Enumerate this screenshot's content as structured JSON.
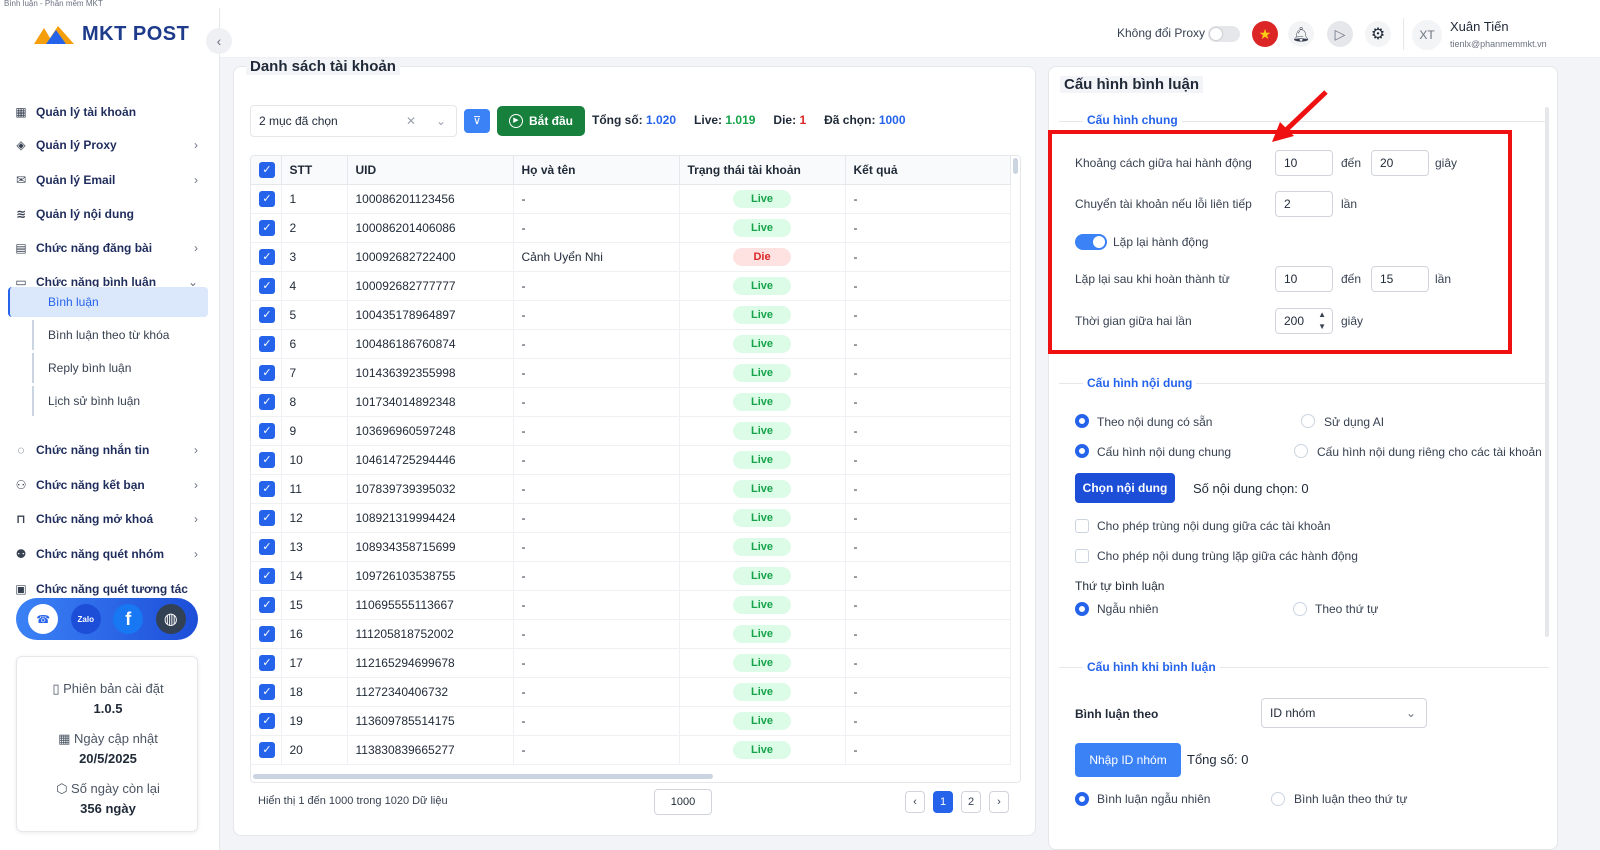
{
  "window": {
    "title": "Bình luận - Phần mềm MKT"
  },
  "brand": {
    "logo_text": "MKT POST",
    "accent": "#2563eb"
  },
  "sidebar": {
    "collapse_icon": "‹",
    "items": [
      {
        "label": "Quản lý tài khoản",
        "icon": "grid-icon",
        "chevron": ""
      },
      {
        "label": "Quản lý Proxy",
        "icon": "layers-icon",
        "chevron": "›"
      },
      {
        "label": "Quản lý Email",
        "icon": "mail-icon",
        "chevron": "›"
      },
      {
        "label": "Quản lý nội dung",
        "icon": "content-icon",
        "chevron": ""
      },
      {
        "label": "Chức năng đăng bài",
        "icon": "post-icon",
        "chevron": "›"
      },
      {
        "label": "Chức năng bình luận",
        "icon": "comment-icon",
        "chevron": "⌄"
      },
      {
        "label": "Chức năng nhắn tin",
        "icon": "chat-icon",
        "chevron": "›"
      },
      {
        "label": "Chức năng kết bạn",
        "icon": "add-friend-icon",
        "chevron": "›"
      },
      {
        "label": "Chức năng mở khoá",
        "icon": "unlock-icon",
        "chevron": "›"
      },
      {
        "label": "Chức năng quét nhóm",
        "icon": "group-icon",
        "chevron": "›"
      },
      {
        "label": "Chức năng quét tương tác",
        "icon": "interaction-icon",
        "chevron": ""
      }
    ],
    "subitems": [
      {
        "label": "Bình luận",
        "active": true
      },
      {
        "label": "Bình luận theo từ khóa",
        "active": false
      },
      {
        "label": "Reply bình luận",
        "active": false
      },
      {
        "label": "Lịch sử bình luận",
        "active": false
      }
    ],
    "social": {
      "zalo": "Zalo",
      "facebook": "f"
    },
    "info": {
      "version_label": "Phiên bản cài đặt",
      "version": "1.0.5",
      "updated_label": "Ngày cập nhật",
      "updated": "20/5/2025",
      "days_label": "Số ngày còn lại",
      "days": "356 ngày"
    }
  },
  "topbar": {
    "proxy_label": "Không đổi Proxy",
    "user_initials": "XT",
    "user_name": "Xuân Tiến",
    "user_email": "tienlx@phanmemmkt.vn"
  },
  "accounts": {
    "title": "Danh sách tài khoản",
    "select_value": "2 mục đã chọn",
    "start_label": "Bắt đầu",
    "stats": {
      "total_label": "Tổng số:",
      "total": "1.020",
      "live_label": "Live:",
      "live": "1.019",
      "die_label": "Die:",
      "die": "1",
      "selected_label": "Đã chọn:",
      "selected": "1000"
    },
    "columns": [
      "STT",
      "UID",
      "Họ và tên",
      "Trạng thái tài khoản",
      "Kết quả"
    ],
    "rows": [
      {
        "stt": "1",
        "uid": "100086201123456",
        "name": "-",
        "status": "Live",
        "result": "-"
      },
      {
        "stt": "2",
        "uid": "100086201406086",
        "name": "-",
        "status": "Live",
        "result": "-"
      },
      {
        "stt": "3",
        "uid": "100092682722400",
        "name": "Cảnh Uyển Nhi",
        "status": "Die",
        "result": "-"
      },
      {
        "stt": "4",
        "uid": "100092682777777",
        "name": "-",
        "status": "Live",
        "result": "-"
      },
      {
        "stt": "5",
        "uid": "100435178964897",
        "name": "-",
        "status": "Live",
        "result": "-"
      },
      {
        "stt": "6",
        "uid": "100486186760874",
        "name": "-",
        "status": "Live",
        "result": "-"
      },
      {
        "stt": "7",
        "uid": "101436392355998",
        "name": "-",
        "status": "Live",
        "result": "-"
      },
      {
        "stt": "8",
        "uid": "101734014892348",
        "name": "-",
        "status": "Live",
        "result": "-"
      },
      {
        "stt": "9",
        "uid": "103696960597248",
        "name": "-",
        "status": "Live",
        "result": "-"
      },
      {
        "stt": "10",
        "uid": "104614725294446",
        "name": "-",
        "status": "Live",
        "result": "-"
      },
      {
        "stt": "11",
        "uid": "107839739395032",
        "name": "-",
        "status": "Live",
        "result": "-"
      },
      {
        "stt": "12",
        "uid": "108921319994424",
        "name": "-",
        "status": "Live",
        "result": "-"
      },
      {
        "stt": "13",
        "uid": "108934358715699",
        "name": "-",
        "status": "Live",
        "result": "-"
      },
      {
        "stt": "14",
        "uid": "109726103538755",
        "name": "-",
        "status": "Live",
        "result": "-"
      },
      {
        "stt": "15",
        "uid": "110695555113667",
        "name": "-",
        "status": "Live",
        "result": "-"
      },
      {
        "stt": "16",
        "uid": "111205818752002",
        "name": "-",
        "status": "Live",
        "result": "-"
      },
      {
        "stt": "17",
        "uid": "112165294699678",
        "name": "-",
        "status": "Live",
        "result": "-"
      },
      {
        "stt": "18",
        "uid": "11272340406732",
        "name": "-",
        "status": "Live",
        "result": "-"
      },
      {
        "stt": "19",
        "uid": "113609785514175",
        "name": "-",
        "status": "Live",
        "result": "-"
      },
      {
        "stt": "20",
        "uid": "113830839665277",
        "name": "-",
        "status": "Live",
        "result": "-"
      }
    ],
    "footer": "Hiển thị 1 đến 1000 trong 1020 Dữ liệu",
    "page_size": "1000",
    "pages": [
      "‹",
      "1",
      "2",
      "›"
    ]
  },
  "config": {
    "title": "Cấu hình bình luận",
    "general": {
      "section": "Cấu hình chung",
      "interval_label": "Khoảng cách giữa hai hành động",
      "interval_from": "10",
      "to_label": "đến",
      "interval_to": "20",
      "seconds": "giây",
      "switch_label": "Chuyển tài khoản nếu lỗi liên tiếp",
      "switch_value": "2",
      "times": "lần",
      "repeat_label": "Lặp lại hành động",
      "repeat_after_label": "Lặp lại sau khi hoàn thành từ",
      "repeat_from": "10",
      "repeat_to": "15",
      "between_label": "Thời gian giữa hai lần",
      "between_value": "200"
    },
    "content": {
      "section": "Cấu hình nội dung",
      "opt_available": "Theo nội dung có sẵn",
      "opt_ai": "Sử dụng AI",
      "opt_common": "Cấu hình nội dung chung",
      "opt_private": "Cấu hình nội dung riêng cho các tài khoản",
      "choose_btn": "Chọn nội dung",
      "chosen_count": "Số nội dung chọn: 0",
      "allow_dup_accounts": "Cho phép trùng nội dung giữa các tài khoản",
      "allow_dup_actions": "Cho phép nội dung trùng lặp giữa các hành động",
      "order_label": "Thứ tự bình luận",
      "order_random": "Ngẫu nhiên",
      "order_seq": "Theo thứ tự"
    },
    "when": {
      "section": "Cấu hình khi bình luận",
      "comment_by_label": "Bình luận theo",
      "comment_by_value": "ID nhóm",
      "import_btn": "Nhập ID nhóm",
      "total": "Tổng số: 0",
      "random": "Bình luận ngẫu nhiên",
      "sequential": "Bình luận theo thứ tự"
    }
  }
}
